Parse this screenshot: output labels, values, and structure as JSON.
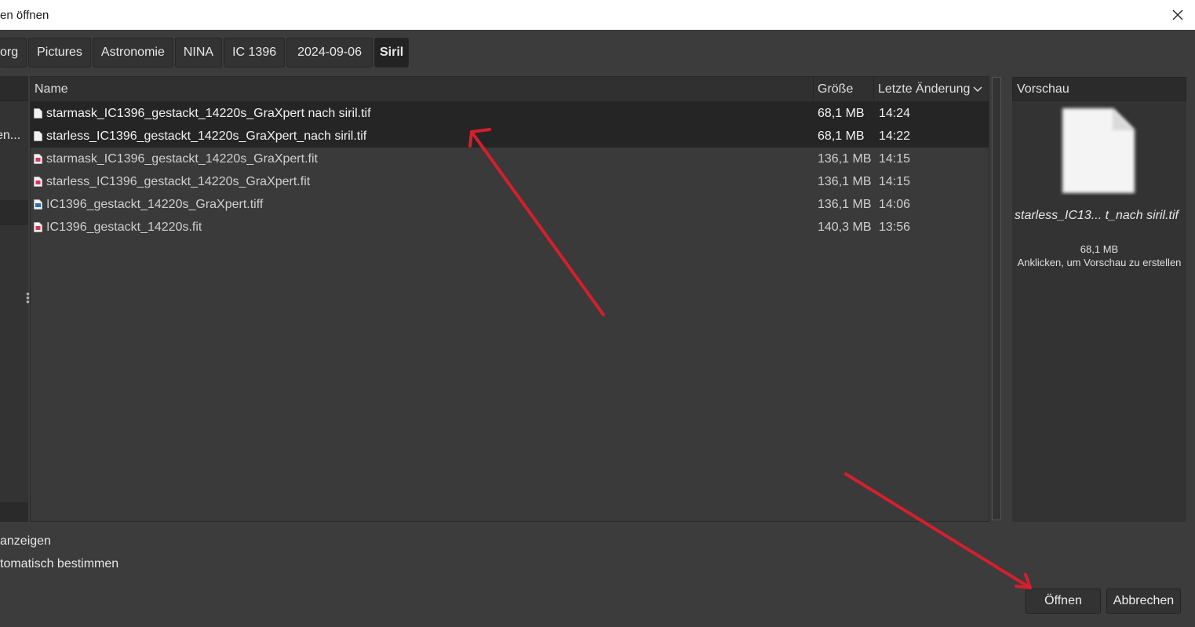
{
  "window": {
    "title": "en öffnen",
    "close_icon": "close-icon"
  },
  "breadcrumb": [
    {
      "label": "org"
    },
    {
      "label": "Pictures"
    },
    {
      "label": "Astronomie"
    },
    {
      "label": "NINA"
    },
    {
      "label": "IC 1396"
    },
    {
      "label": "2024-09-06"
    },
    {
      "label": "Siril",
      "active": true
    }
  ],
  "sidebar": {
    "selected_item": "en..."
  },
  "filelist": {
    "columns": {
      "name": "Name",
      "size": "Größe",
      "modified": "Letzte Änderung"
    },
    "sort_icon": "chevron-down-icon",
    "rows": [
      {
        "name": "starmask_IC1396_gestackt_14220s_GraXpert nach siril.tif",
        "size": "68,1 MB",
        "modified": "14:24",
        "icon": "document-icon",
        "selected": true
      },
      {
        "name": "starless_IC1396_gestackt_14220s_GraXpert_nach siril.tif",
        "size": "68,1 MB",
        "modified": "14:22",
        "icon": "document-icon",
        "selected": true
      },
      {
        "name": "starmask_IC1396_gestackt_14220s_GraXpert.fit",
        "size": "136,1 MB",
        "modified": "14:15",
        "icon": "fits-file-icon",
        "selected": false
      },
      {
        "name": "starless_IC1396_gestackt_14220s_GraXpert.fit",
        "size": "136,1 MB",
        "modified": "14:15",
        "icon": "fits-file-icon",
        "selected": false
      },
      {
        "name": "IC1396_gestackt_14220s_GraXpert.tiff",
        "size": "136,1 MB",
        "modified": "14:06",
        "icon": "image-file-icon",
        "selected": false
      },
      {
        "name": "IC1396_gestackt_14220s.fit",
        "size": "140,3 MB",
        "modified": "13:56",
        "icon": "fits-file-icon",
        "selected": false
      }
    ]
  },
  "preview": {
    "header": "Vorschau",
    "file_name": "starless_IC13... t_nach siril.tif",
    "size": "68,1 MB",
    "hint": "Anklicken, um Vorschau zu erstellen"
  },
  "options": {
    "show_hidden": "anzeigen",
    "auto_type": "tomatisch bestimmen"
  },
  "buttons": {
    "open": "Öffnen",
    "cancel": "Abbrechen"
  },
  "colors": {
    "annotation_arrow": "#d41f2e",
    "background": "#3c3c3c",
    "selection": "#252525"
  }
}
